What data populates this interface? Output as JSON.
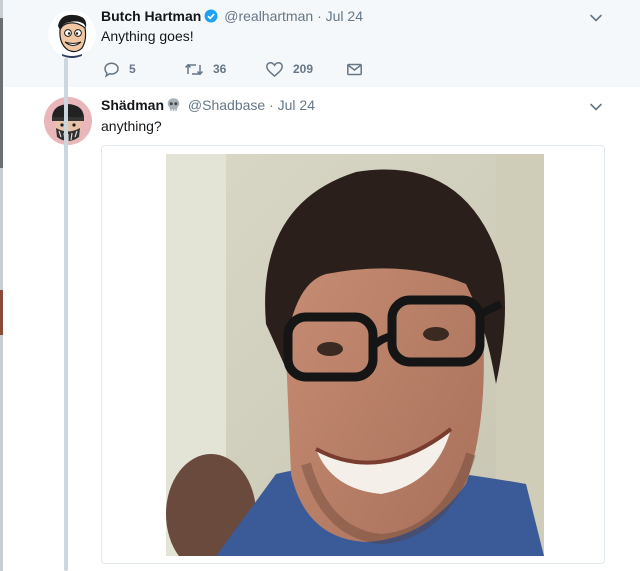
{
  "tweets": [
    {
      "display_name": "Butch Hartman",
      "handle": "@realhartman",
      "separator": "·",
      "date": "Jul 24",
      "text": "Anything goes!",
      "avatar_icon": "cartoon-avatar-icon",
      "verified_icon": "verified-badge-icon",
      "actions": {
        "replies": "5",
        "retweets": "36",
        "likes": "209"
      }
    },
    {
      "display_name": "Shädman",
      "handle": "@Shadbase",
      "separator": "·",
      "date": "Jul 24",
      "text": "anything?",
      "avatar_icon": "skull-mask-avatar-icon",
      "name_emoji_icon": "skull-icon",
      "media": {
        "type": "photo",
        "description_icon": "photo-smiling-man-glasses"
      }
    }
  ],
  "colors": {
    "accent_blue": "#1da1f2",
    "text_primary": "#14171a",
    "text_secondary": "#657786",
    "thread_line": "#ccd6dd",
    "parent_bg": "#f5f8fa"
  }
}
